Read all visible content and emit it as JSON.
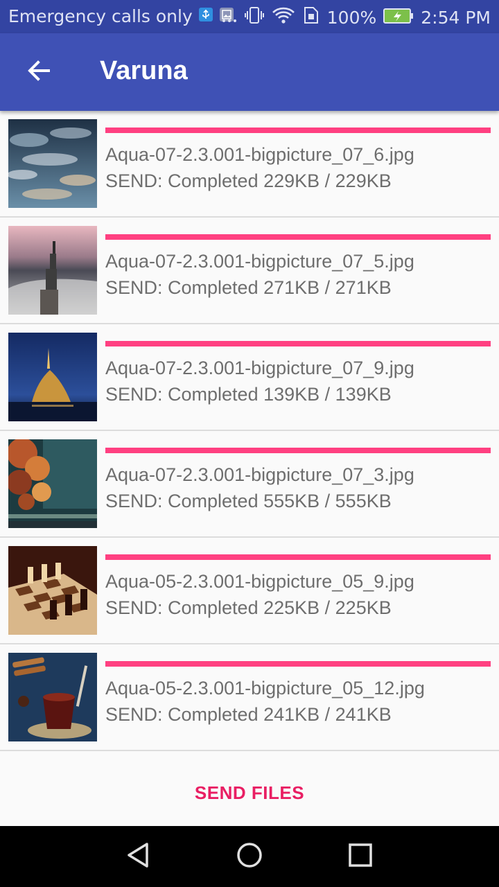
{
  "status_bar": {
    "carrier": "Emergency calls only",
    "battery": "100%",
    "time": "2:54 PM",
    "icons": [
      "usb-icon",
      "image-icon",
      "more-icon",
      "vibrate-icon",
      "wifi-icon",
      "sim-icon",
      "battery-icon"
    ]
  },
  "app_bar": {
    "title": "Varuna",
    "back_icon": "arrow-left-icon",
    "color": "#3f51b5"
  },
  "transfers": [
    {
      "filename": "Aqua-07-2.3.001-bigpicture_07_6.jpg",
      "status": "SEND: Completed 229KB / 229KB",
      "progress": 1.0,
      "thumb": "cloudy-sky"
    },
    {
      "filename": "Aqua-07-2.3.001-bigpicture_07_5.jpg",
      "status": "SEND: Completed 271KB / 271KB",
      "progress": 1.0,
      "thumb": "sea-pier"
    },
    {
      "filename": "Aqua-07-2.3.001-bigpicture_07_9.jpg",
      "status": "SEND: Completed 139KB / 139KB",
      "progress": 1.0,
      "thumb": "castle-night"
    },
    {
      "filename": "Aqua-07-2.3.001-bigpicture_07_3.jpg",
      "status": "SEND: Completed 555KB / 555KB",
      "progress": 1.0,
      "thumb": "autumn-water"
    },
    {
      "filename": "Aqua-05-2.3.001-bigpicture_05_9.jpg",
      "status": "SEND: Completed 225KB / 225KB",
      "progress": 1.0,
      "thumb": "chess-board"
    },
    {
      "filename": "Aqua-05-2.3.001-bigpicture_05_12.jpg",
      "status": "SEND: Completed 241KB / 241KB",
      "progress": 1.0,
      "thumb": "tea-cinnamon"
    }
  ],
  "actions": {
    "send_files": "SEND FILES"
  },
  "colors": {
    "accent": "#ff4081",
    "button_text": "#e91e63",
    "primary": "#3f51b5",
    "status_bar": "#3344a2"
  }
}
